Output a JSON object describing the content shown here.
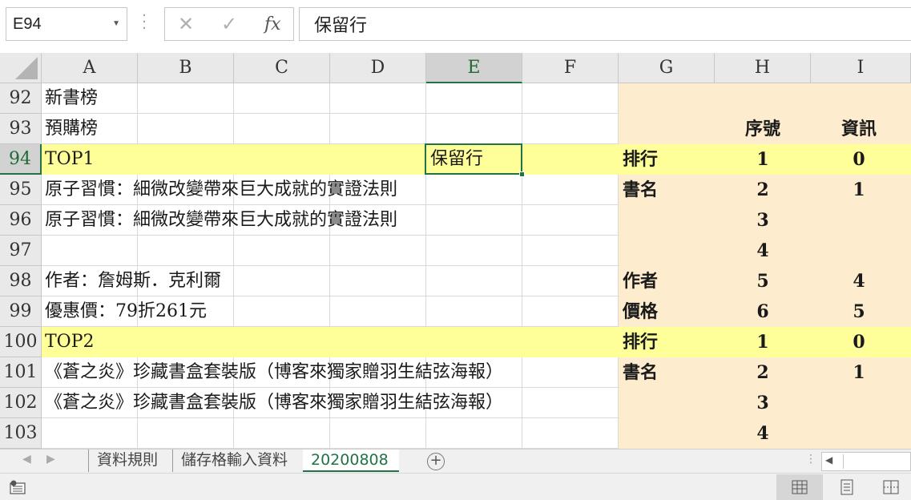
{
  "formula_bar": {
    "name_box": "E94",
    "cancel_icon": "close-icon",
    "enter_icon": "check-icon",
    "fx_label": "fx",
    "formula": "保留行"
  },
  "columns": [
    "A",
    "B",
    "C",
    "D",
    "E",
    "F",
    "G",
    "H",
    "I"
  ],
  "selected_column": "E",
  "selected_row": "94",
  "rows": [
    {
      "num": "92",
      "a": "新書榜",
      "g": "",
      "h": "",
      "i": ""
    },
    {
      "num": "93",
      "a": "預購榜",
      "g": "",
      "h": "序號",
      "i": "資訊"
    },
    {
      "num": "94",
      "a": "TOP1",
      "e": "保留行",
      "g": "排行",
      "h": "1",
      "i": "0"
    },
    {
      "num": "95",
      "a": "原子習慣：細微改變帶來巨大成就的實證法則",
      "g": "書名",
      "h": "2",
      "i": "1"
    },
    {
      "num": "96",
      "a": "原子習慣：細微改變帶來巨大成就的實證法則",
      "g": "",
      "h": "3",
      "i": ""
    },
    {
      "num": "97",
      "a": "",
      "g": "",
      "h": "4",
      "i": ""
    },
    {
      "num": "98",
      "a": "作者：詹姆斯．克利爾",
      "g": "作者",
      "h": "5",
      "i": "4"
    },
    {
      "num": "99",
      "a": "優惠價：79折261元",
      "g": "價格",
      "h": "6",
      "i": "5"
    },
    {
      "num": "100",
      "a": "TOP2",
      "g": "排行",
      "h": "1",
      "i": "0"
    },
    {
      "num": "101",
      "a": "《蒼之炎》珍藏書盒套裝版（博客來獨家贈羽生結弦海報）",
      "g": "書名",
      "h": "2",
      "i": "1"
    },
    {
      "num": "102",
      "a": "《蒼之炎》珍藏書盒套裝版（博客來獨家贈羽生結弦海報）",
      "g": "",
      "h": "3",
      "i": ""
    },
    {
      "num": "103",
      "a": "",
      "g": "",
      "h": "4",
      "i": ""
    }
  ],
  "highlight_rows": [
    "94",
    "100"
  ],
  "colors": {
    "accent": "#217346",
    "peach_fill": "#fdeccd",
    "yellow_fill": "#ffff99"
  },
  "sheet_tabs": [
    {
      "label": "資料規則",
      "active": false
    },
    {
      "label": "儲存格輸入資料",
      "active": false
    },
    {
      "label": "20200808",
      "active": true
    }
  ],
  "status_bar": {
    "macro_icon": "record-macro-icon",
    "views": [
      "normal-view-icon",
      "page-layout-icon",
      "page-break-preview-icon"
    ]
  }
}
